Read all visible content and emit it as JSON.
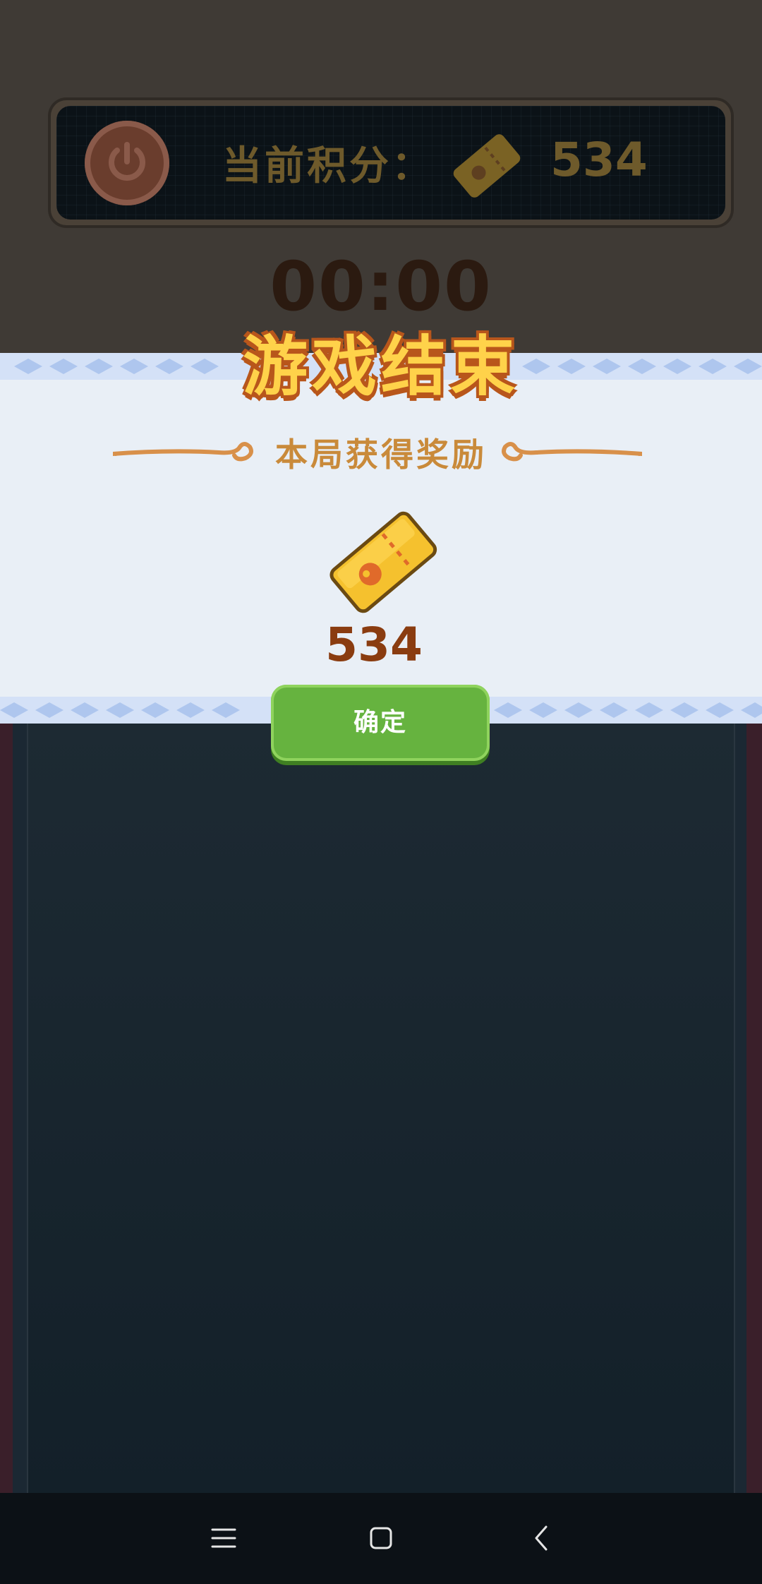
{
  "hud": {
    "score_label": "当前积分：",
    "score_value": "534",
    "timer": "00:00"
  },
  "dialog": {
    "title": "游戏结束",
    "reward_title": "本局获得奖励",
    "reward_amount": "534",
    "confirm_label": "确定"
  },
  "icons": {
    "power": "power-icon",
    "ticket": "ticket-icon",
    "nav_menu": "menu-icon",
    "nav_home": "home-icon",
    "nav_back": "back-icon"
  },
  "colors": {
    "title_fill": "#ffd24a",
    "title_outline": "#b8561b",
    "reward_text": "#8a3c10",
    "confirm_button": "#66b33f"
  }
}
